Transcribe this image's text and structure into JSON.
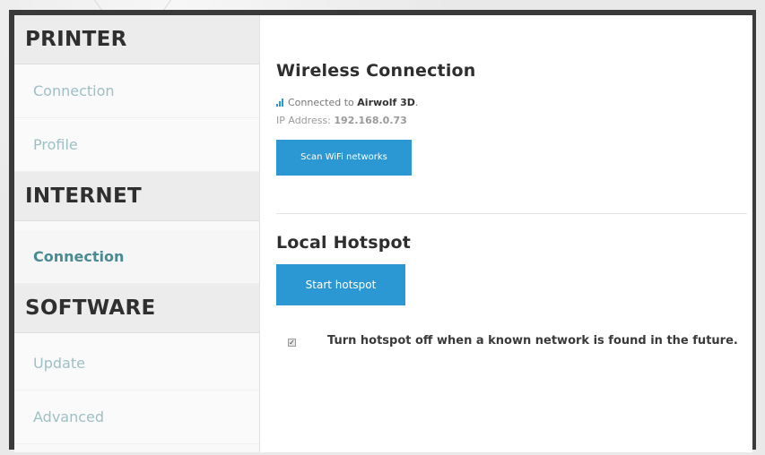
{
  "sidebar": {
    "sections": [
      {
        "title": "PRINTER",
        "items": [
          {
            "label": "Connection"
          },
          {
            "label": "Profile"
          }
        ]
      },
      {
        "title": "INTERNET",
        "items": [
          {
            "label": "Connection",
            "active": true
          }
        ]
      },
      {
        "title": "SOFTWARE",
        "items": [
          {
            "label": "Update"
          },
          {
            "label": "Advanced"
          }
        ]
      }
    ]
  },
  "wireless": {
    "heading": "Wireless Connection",
    "status_prefix": "Connected to ",
    "network_name": "Airwolf 3D",
    "status_suffix": ".",
    "ip_label": "IP Address: ",
    "ip_value": "192.168.0.73",
    "scan_button": "Scan WiFi networks"
  },
  "hotspot": {
    "heading": "Local Hotspot",
    "start_button": "Start hotspot",
    "auto_off_label": "Turn hotspot off when a known network is found in the future.",
    "auto_off_checked": true
  },
  "colors": {
    "accent": "#2b97d3",
    "nav_text": "#9ec0c5",
    "nav_active": "#4a8a92"
  },
  "icons": {
    "status": "signal-bars-icon",
    "checkbox": "check-icon"
  }
}
